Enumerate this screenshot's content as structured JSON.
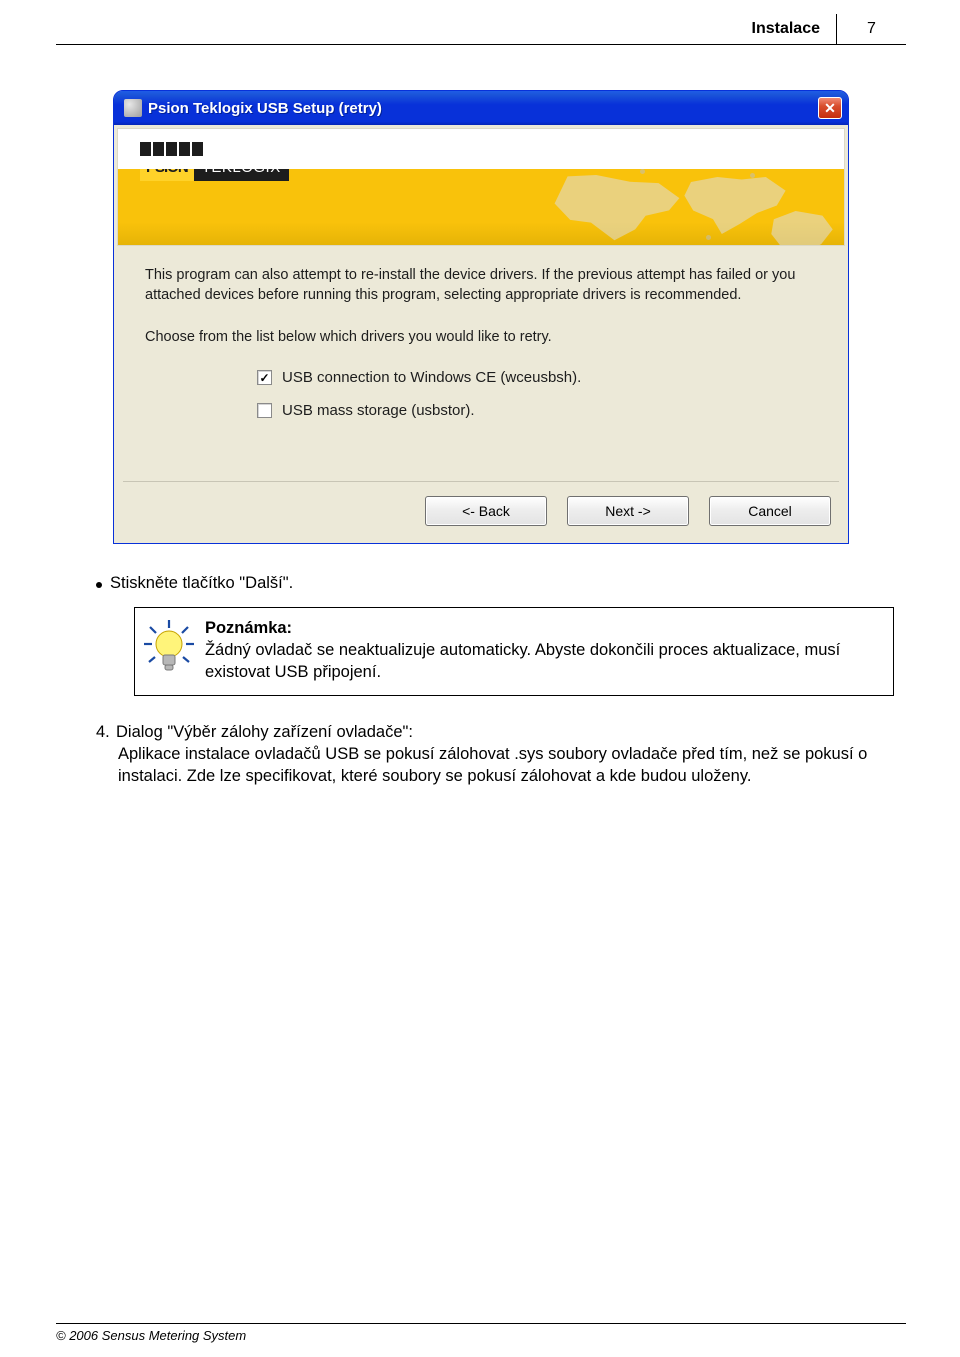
{
  "page": {
    "header_title": "Instalace",
    "number": "7",
    "footer": "© 2006 Sensus Metering System"
  },
  "xp": {
    "title": "Psion Teklogix USB Setup (retry)",
    "logo_psion": "PSION",
    "logo_teklogix": "TEKLOGIX",
    "paragraph1": "This program can also attempt to re-install the device drivers. If the previous attempt has failed or you attached devices before running this program, selecting appropriate drivers is recommended.",
    "paragraph2": "Choose from the list below which drivers you would like to retry.",
    "check1_label": "USB connection to Windows CE (wceusbsh).",
    "check1_checked": true,
    "check2_label": "USB mass storage (usbstor).",
    "check2_checked": false,
    "btn_back": "<- Back",
    "btn_next": "Next ->",
    "btn_cancel": "Cancel"
  },
  "bullet": {
    "text": "Stiskněte tlačítko \"Další\"."
  },
  "note": {
    "title": "Poznámka:",
    "text": "Žádný ovladač se neaktualizuje automaticky. Abyste dokončili proces aktualizace, musí existovat USB připojení."
  },
  "step4": {
    "num": "4.",
    "title": "Dialog \"Výběr zálohy zařízení ovladače\":",
    "line1": "Aplikace instalace ovladačů USB se pokusí zálohovat .sys soubory ovladače před tím, než se pokusí o instalaci. Zde lze specifikovat, které soubory se pokusí zálohovat a kde budou uloženy."
  }
}
